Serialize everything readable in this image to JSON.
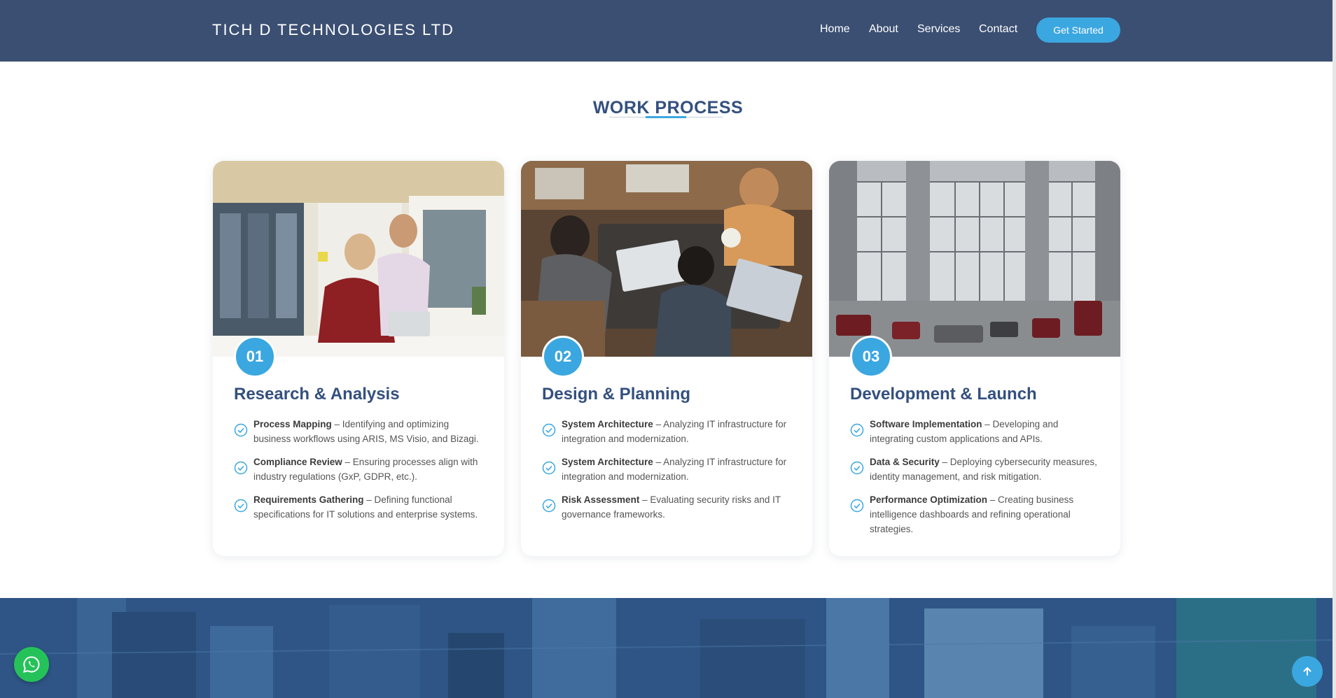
{
  "header": {
    "brand": "TICH D TECHNOLOGIES LTD",
    "nav": [
      "Home",
      "About",
      "Services",
      "Contact"
    ],
    "cta": "Get Started"
  },
  "section": {
    "title": "WORK PROCESS"
  },
  "cards": [
    {
      "number": "01",
      "title": "Research & Analysis",
      "image_icon": "office-collaboration-photo",
      "items": [
        {
          "bold": "Process Mapping",
          "text": " – Identifying and optimizing business workflows using ARIS, MS Visio, and Bizagi."
        },
        {
          "bold": "Compliance Review",
          "text": " – Ensuring processes align with industry regulations (GxP, GDPR, etc.)."
        },
        {
          "bold": "Requirements Gathering",
          "text": " – Defining functional specifications for IT solutions and enterprise systems."
        }
      ]
    },
    {
      "number": "02",
      "title": "Design & Planning",
      "image_icon": "team-laptops-photo",
      "items": [
        {
          "bold": "System Architecture",
          "text": " – Analyzing IT infrastructure for integration and modernization."
        },
        {
          "bold": "System Architecture",
          "text": " – Analyzing IT infrastructure for integration and modernization."
        },
        {
          "bold": "Risk Assessment",
          "text": " – Evaluating security risks and IT governance frameworks."
        }
      ]
    },
    {
      "number": "03",
      "title": "Development & Launch",
      "image_icon": "glass-lobby-photo",
      "items": [
        {
          "bold": "Software Implementation",
          "text": " – Developing and integrating custom applications and APIs."
        },
        {
          "bold": "Data & Security",
          "text": " – Deploying cybersecurity measures, identity management, and risk mitigation."
        },
        {
          "bold": "Performance Optimization",
          "text": " – Creating business intelligence dashboards and refining operational strategies."
        }
      ]
    }
  ],
  "colors": {
    "header_bg": "#3b4f72",
    "accent": "#3ba7e0",
    "heading": "#34507e",
    "whatsapp": "#25c25a",
    "banner": "#2e5585"
  },
  "floating": {
    "whatsapp_icon": "whatsapp-icon",
    "scroll_top_icon": "arrow-up-icon"
  }
}
